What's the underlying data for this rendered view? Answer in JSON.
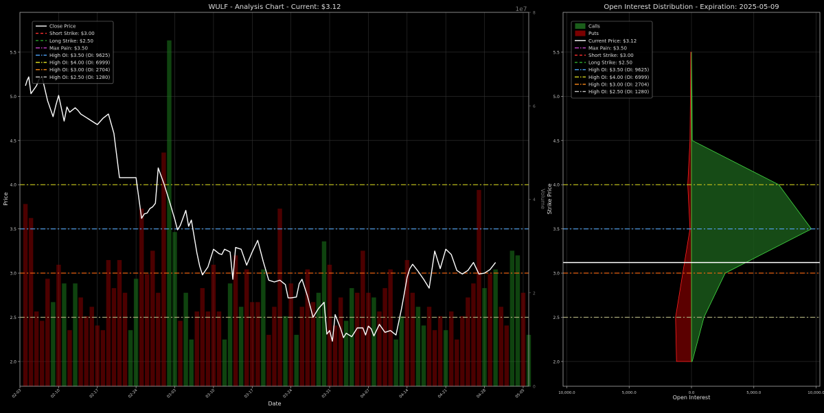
{
  "chart_data": [
    {
      "type": "line",
      "title": "WULF - Analysis Chart - Current: $3.12",
      "xlabel": "Date",
      "ylabel": "Price",
      "y2label": "Volume",
      "y2_offset_label": "1e7",
      "ylim": [
        1.72,
        5.95
      ],
      "y2lim": [
        0,
        8.0
      ],
      "xlim": [
        0,
        92
      ],
      "yticks": [
        "2.0",
        "2.5",
        "3.0",
        "3.5",
        "4.0",
        "4.5",
        "5.0",
        "5.5"
      ],
      "y2ticks": [
        "0",
        "2",
        "4",
        "6",
        "8"
      ],
      "xtick_labels": [
        "02-03",
        "02-10",
        "02-17",
        "02-24",
        "03-03",
        "03-10",
        "03-17",
        "03-24",
        "03-31",
        "04-07",
        "04-14",
        "04-21",
        "04-28",
        "05-05"
      ],
      "xtick_days": [
        0,
        7,
        14,
        21,
        28,
        35,
        42,
        49,
        56,
        63,
        70,
        77,
        84,
        91
      ],
      "grid": true,
      "legend_position": "top-left",
      "legend": [
        {
          "label": "Close Price",
          "color": "#ffffff",
          "dash": "solid"
        },
        {
          "label": "Short Strike: $3.00",
          "color": "#ff3030",
          "dash": "dashed"
        },
        {
          "label": "Long Strike: $2.50",
          "color": "#2ca02c",
          "dash": "dashed"
        },
        {
          "label": "Max Pain: $3.50",
          "color": "#cc44cc",
          "dash": "dashdot"
        },
        {
          "label": "High OI: $3.50 (OI: 9625)",
          "color": "#4fa8ff",
          "dash": "dashdot"
        },
        {
          "label": "High OI: $4.00 (OI: 6999)",
          "color": "#d8d820",
          "dash": "dashdot"
        },
        {
          "label": "High OI: $3.00 (OI: 2704)",
          "color": "#ff8c1a",
          "dash": "dashdot"
        },
        {
          "label": "High OI: $2.50 (OI: 1280)",
          "color": "#c8c8c8",
          "dash": "dashdot"
        }
      ],
      "hlines": [
        {
          "y": 4.0,
          "color": "#b8b81a"
        },
        {
          "y": 3.5,
          "color": "#4f9ae0"
        },
        {
          "y": 3.0,
          "color": "#ff6a10"
        },
        {
          "y": 2.5,
          "color": "#a8a878"
        }
      ],
      "close_price": {
        "x": [
          1,
          1.3,
          1.6,
          2,
          3,
          3.5,
          4,
          5,
          6,
          6.5,
          7,
          8,
          8.5,
          9,
          10,
          10.5,
          11,
          12,
          13,
          14,
          15,
          16,
          17,
          18,
          19,
          20,
          21,
          22,
          22.5,
          23,
          23.5,
          24,
          24.5,
          25,
          26,
          27,
          28,
          28.5,
          29,
          30,
          30.5,
          31,
          32,
          32.5,
          33,
          34,
          35,
          36,
          36.5,
          37,
          38,
          38.5,
          39,
          40,
          41,
          42,
          43,
          43.5,
          44,
          45,
          46,
          47,
          48,
          48.5,
          49,
          50,
          50.5,
          51,
          52,
          53,
          54,
          55,
          55.5,
          56,
          56.5,
          57,
          58,
          58.5,
          59,
          60,
          61,
          62,
          62.5,
          63,
          63.5,
          64,
          65,
          66,
          67,
          68,
          69,
          69.5,
          70,
          70.5,
          71,
          72,
          73,
          74,
          75,
          76,
          77,
          78,
          79,
          80,
          81,
          82,
          83,
          84,
          85,
          86,
          87,
          88,
          89,
          89.5,
          90,
          91,
          91.5,
          92
        ],
        "values": [
          5.12,
          5.18,
          5.22,
          5.03,
          5.12,
          5.2,
          5.22,
          4.95,
          4.77,
          4.9,
          5.01,
          4.72,
          4.88,
          4.82,
          4.87,
          4.84,
          4.8,
          4.76,
          4.72,
          4.68,
          4.75,
          4.8,
          4.58,
          4.08,
          4.08,
          4.08,
          4.08,
          3.62,
          3.67,
          3.68,
          3.73,
          3.75,
          3.79,
          4.19,
          4.02,
          3.82,
          3.61,
          3.49,
          3.54,
          3.71,
          3.53,
          3.6,
          3.23,
          3.08,
          2.98,
          3.07,
          3.27,
          3.22,
          3.21,
          3.27,
          3.24,
          2.93,
          3.29,
          3.27,
          3.09,
          3.24,
          3.37,
          3.25,
          3.13,
          2.92,
          2.9,
          2.92,
          2.87,
          2.72,
          2.72,
          2.73,
          2.88,
          2.93,
          2.74,
          2.5,
          2.6,
          2.67,
          2.31,
          2.35,
          2.23,
          2.53,
          2.37,
          2.27,
          2.32,
          2.28,
          2.38,
          2.38,
          2.3,
          2.4,
          2.37,
          2.29,
          2.42,
          2.33,
          2.35,
          2.3,
          2.6,
          2.77,
          2.95,
          3.05,
          3.1,
          3.02,
          2.93,
          2.83,
          3.25,
          3.05,
          3.27,
          3.21,
          3.03,
          2.99,
          3.03,
          3.12,
          2.99,
          3.0,
          3.04,
          3.12
        ]
      },
      "volume_series": {
        "up_color": "#1b7a1b",
        "down_color": "#8b0000",
        "x": [
          1,
          2,
          3,
          4,
          5,
          6,
          7,
          8,
          9,
          10,
          11,
          12,
          13,
          14,
          15,
          16,
          17,
          18,
          19,
          20,
          21,
          22,
          23,
          24,
          25,
          26,
          27,
          28,
          29,
          30,
          31,
          32,
          33,
          34,
          35,
          36,
          37,
          38,
          39,
          40,
          41,
          42,
          43,
          44,
          45,
          46,
          47,
          48,
          49,
          50,
          51,
          52,
          53,
          54,
          55,
          56,
          57,
          58,
          59,
          60,
          61,
          62,
          63,
          64,
          65,
          66,
          67,
          68,
          69,
          70,
          71,
          72,
          73,
          74,
          75,
          76,
          77,
          78,
          79,
          80,
          81,
          82,
          83,
          84,
          85,
          86,
          87,
          88,
          89,
          90,
          91,
          92
        ],
        "values": [
          3.9,
          3.6,
          1.6,
          1.4,
          2.3,
          1.8,
          2.6,
          2.2,
          1.2,
          2.2,
          1.9,
          1.5,
          1.7,
          1.3,
          1.2,
          2.7,
          2.1,
          2.7,
          2.0,
          1.2,
          2.3,
          3.8,
          2.4,
          2.9,
          2.0,
          5.0,
          7.4,
          3.3,
          1.4,
          2.0,
          1.0,
          1.6,
          2.1,
          1.6,
          2.6,
          1.6,
          1.0,
          2.2,
          2.8,
          1.7,
          2.5,
          1.8,
          1.8,
          2.5,
          1.1,
          1.7,
          3.8,
          1.5,
          2.2,
          1.1,
          1.7,
          2.5,
          1.8,
          2.0,
          3.1,
          2.6,
          1.3,
          1.9,
          1.4,
          2.1,
          2.0,
          2.9,
          2.0,
          1.9,
          1.6,
          2.1,
          2.5,
          1.0,
          1.5,
          2.7,
          2.0,
          1.7,
          1.3,
          1.7,
          1.2,
          1.5,
          1.2,
          1.6,
          1.0,
          1.5,
          1.9,
          2.2,
          4.2,
          2.1,
          2.4,
          2.5,
          1.7,
          1.3,
          2.9,
          2.8,
          2.0,
          1.1
        ],
        "up": [
          false,
          false,
          false,
          false,
          false,
          true,
          false,
          true,
          false,
          true,
          false,
          false,
          false,
          false,
          false,
          false,
          false,
          false,
          false,
          true,
          true,
          false,
          false,
          false,
          false,
          false,
          true,
          true,
          false,
          true,
          true,
          false,
          false,
          false,
          false,
          false,
          true,
          true,
          false,
          true,
          false,
          false,
          false,
          true,
          false,
          false,
          false,
          true,
          false,
          true,
          false,
          false,
          false,
          true,
          true,
          false,
          false,
          false,
          true,
          true,
          false,
          false,
          false,
          true,
          false,
          false,
          false,
          true,
          true,
          false,
          false,
          true,
          true,
          false,
          false,
          false,
          true,
          false,
          false,
          false,
          false,
          false,
          false,
          true,
          false,
          true,
          false,
          false,
          true,
          true,
          false,
          true
        ]
      }
    },
    {
      "type": "area",
      "title": "Open Interest Distribution - Expiration: 2025-05-09",
      "xlabel": "Open Interest",
      "ylabel": "Strike Price",
      "ylim": [
        1.72,
        5.95
      ],
      "xlim": [
        -10300,
        10300
      ],
      "xtick_labels": [
        "10,000.0",
        "5,000.0",
        "0.0",
        "5,000.0",
        "10,000.0"
      ],
      "xtick_values": [
        -10000,
        -5000,
        0,
        5000,
        10000
      ],
      "yticks": [
        "2.0",
        "2.5",
        "3.0",
        "3.5",
        "4.0",
        "4.5",
        "5.0",
        "5.5"
      ],
      "grid": true,
      "legend_position": "top-left",
      "legend": [
        {
          "label": "Calls",
          "color": "#1b5e1b",
          "kind": "patch"
        },
        {
          "label": "Puts",
          "color": "#7a0000",
          "kind": "patch"
        },
        {
          "label": "Current Price: $3.12",
          "color": "#ffffff",
          "dash": "solid"
        },
        {
          "label": "Max Pain: $3.50",
          "color": "#cc44cc",
          "dash": "dashdot"
        },
        {
          "label": "Short Strike: $3.00",
          "color": "#ff3030",
          "dash": "dashed"
        },
        {
          "label": "Long Strike: $2.50",
          "color": "#2ca02c",
          "dash": "dashed"
        },
        {
          "label": "High OI: $3.50 (OI: 9625)",
          "color": "#4fa8ff",
          "dash": "dashdot"
        },
        {
          "label": "High OI: $4.00 (OI: 6999)",
          "color": "#d8d820",
          "dash": "dashdot"
        },
        {
          "label": "High OI: $3.00 (OI: 2704)",
          "color": "#ff8c1a",
          "dash": "dashdot"
        },
        {
          "label": "High OI: $2.50 (OI: 1280)",
          "color": "#c8c8c8",
          "dash": "dashdot"
        }
      ],
      "hlines": [
        {
          "y": 4.0,
          "color": "#b8b81a"
        },
        {
          "y": 3.5,
          "color": "#4f9ae0"
        },
        {
          "y": 3.0,
          "color": "#ff6a10"
        },
        {
          "y": 2.5,
          "color": "#a8a878"
        }
      ],
      "current_price": 3.12,
      "strikes": [
        2.0,
        2.5,
        3.0,
        3.5,
        4.0,
        4.5,
        5.0,
        5.5
      ],
      "calls": [
        60,
        1000,
        2704,
        9625,
        6999,
        60,
        40,
        0
      ],
      "puts": [
        1200,
        1280,
        700,
        120,
        300,
        120,
        80,
        60
      ]
    }
  ]
}
